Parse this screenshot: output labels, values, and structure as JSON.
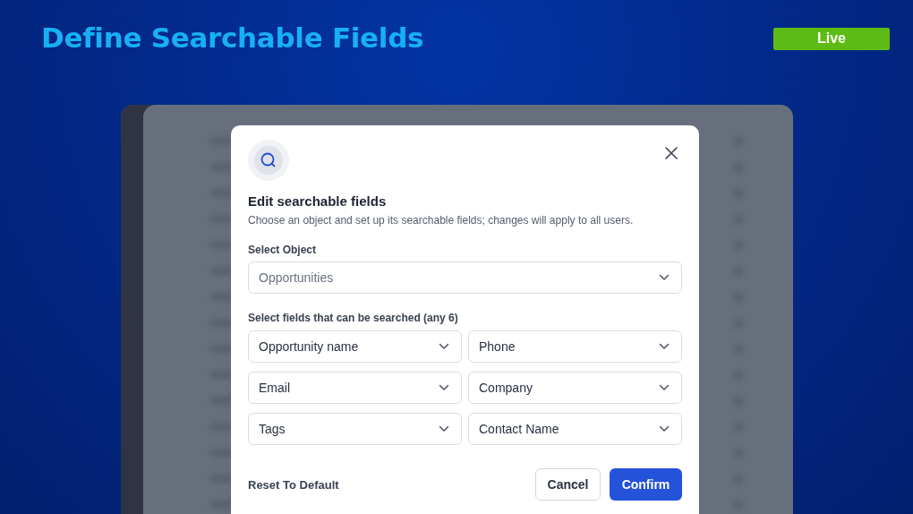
{
  "header": {
    "title": "Define Searchable Fields",
    "badge": "Live"
  },
  "dialog": {
    "title": "Edit searchable fields",
    "description": "Choose an object and set up its searchable fields; changes will apply to all users.",
    "object_label": "Select Object",
    "object_select": {
      "placeholder": "Opportunities"
    },
    "fields_label": "Select fields that can be searched (any 6)",
    "fields": [
      {
        "value": "Opportunity name"
      },
      {
        "value": "Phone"
      },
      {
        "value": "Email"
      },
      {
        "value": "Company"
      },
      {
        "value": "Tags"
      },
      {
        "value": "Contact Name"
      }
    ],
    "buttons": [
      {
        "label": "Reset To Default",
        "kind": "link"
      },
      {
        "label": "Cancel",
        "kind": "secondary"
      },
      {
        "label": "Confirm",
        "kind": "primary"
      }
    ]
  }
}
